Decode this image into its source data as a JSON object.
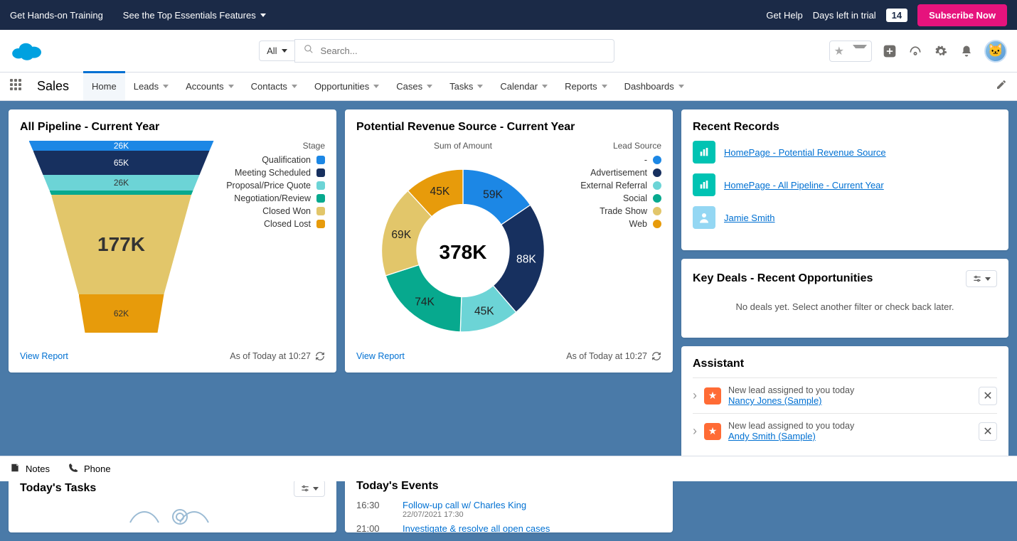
{
  "topbar": {
    "training": "Get Hands-on Training",
    "features": "See the Top Essentials Features",
    "get_help": "Get Help",
    "days_label": "Days left in trial",
    "days_value": "14",
    "subscribe": "Subscribe Now"
  },
  "search": {
    "scope": "All",
    "placeholder": "Search..."
  },
  "nav": {
    "app": "Sales",
    "tabs": [
      "Home",
      "Leads",
      "Accounts",
      "Contacts",
      "Opportunities",
      "Cases",
      "Tasks",
      "Calendar",
      "Reports",
      "Dashboards"
    ]
  },
  "pipeline": {
    "title": "All Pipeline - Current Year",
    "legend_title": "Stage",
    "stages": [
      {
        "name": "Qualification",
        "value": "26K",
        "color": "#1c87e5"
      },
      {
        "name": "Meeting Scheduled",
        "value": "65K",
        "color": "#17305f"
      },
      {
        "name": "Proposal/Price Quote",
        "value": "26K",
        "color": "#6cd4d6"
      },
      {
        "name": "Negotiation/Review",
        "value": "",
        "color": "#07a98e"
      },
      {
        "name": "Closed Won",
        "value": "177K",
        "color": "#e2c66a"
      },
      {
        "name": "Closed Lost",
        "value": "62K",
        "color": "#e79b0b"
      }
    ],
    "view_report": "View Report",
    "as_of": "As of Today at 10:27"
  },
  "revenue": {
    "title": "Potential Revenue Source - Current Year",
    "sub": "Sum of Amount",
    "legend_title": "Lead Source",
    "center": "378K",
    "sources": [
      {
        "name": "-",
        "label": "59K",
        "value": 59,
        "color": "#1c87e5"
      },
      {
        "name": "Advertisement",
        "label": "88K",
        "value": 88,
        "color": "#17305f"
      },
      {
        "name": "External Referral",
        "label": "45K",
        "value": 45,
        "color": "#6cd4d6"
      },
      {
        "name": "Social",
        "label": "74K",
        "value": 74,
        "color": "#07a98e"
      },
      {
        "name": "Trade Show",
        "label": "69K",
        "value": 69,
        "color": "#e2c66a"
      },
      {
        "name": "Web",
        "label": "45K",
        "value": 45,
        "color": "#e79b0b"
      }
    ],
    "view_report": "View Report",
    "as_of": "As of Today at 10:27"
  },
  "recent": {
    "title": "Recent Records",
    "items": [
      {
        "type": "report",
        "label": "HomePage - Potential Revenue Source"
      },
      {
        "type": "report",
        "label": "HomePage - All Pipeline - Current Year"
      },
      {
        "type": "contact",
        "label": "Jamie Smith"
      }
    ]
  },
  "deals": {
    "title": "Key Deals - Recent Opportunities",
    "empty": "No deals yet. Select another filter or check back later."
  },
  "tasks": {
    "title": "Today's Tasks"
  },
  "events": {
    "title": "Today's Events",
    "rows": [
      {
        "time": "16:30",
        "title": "Follow-up call w/ Charles King",
        "sub": "22/07/2021 17:30"
      },
      {
        "time": "21:00",
        "title": "Investigate & resolve all open cases",
        "sub": ""
      }
    ]
  },
  "assistant": {
    "title": "Assistant",
    "items": [
      {
        "msg": "New lead assigned to you today",
        "link": "Nancy Jones (Sample)"
      },
      {
        "msg": "New lead assigned to you today",
        "link": "Andy Smith (Sample)"
      }
    ]
  },
  "bottom": {
    "notes": "Notes",
    "phone": "Phone"
  },
  "chart_data": [
    {
      "type": "funnel",
      "title": "All Pipeline - Current Year",
      "legend_title": "Stage",
      "categories": [
        "Qualification",
        "Meeting Scheduled",
        "Proposal/Price Quote",
        "Negotiation/Review",
        "Closed Won",
        "Closed Lost"
      ],
      "values_label": [
        "26K",
        "65K",
        "26K",
        "",
        "177K",
        "62K"
      ],
      "values": [
        26,
        65,
        26,
        0,
        177,
        62
      ],
      "colors": [
        "#1c87e5",
        "#17305f",
        "#6cd4d6",
        "#07a98e",
        "#e2c66a",
        "#e79b0b"
      ]
    },
    {
      "type": "donut",
      "title": "Potential Revenue Source - Current Year",
      "subtitle": "Sum of Amount",
      "legend_title": "Lead Source",
      "center_label": "378K",
      "series": [
        {
          "name": "Sum of Amount",
          "values": [
            59,
            88,
            45,
            74,
            69,
            45
          ],
          "labels": [
            "59K",
            "88K",
            "45K",
            "74K",
            "69K",
            "45K"
          ]
        }
      ],
      "categories": [
        "-",
        "Advertisement",
        "External Referral",
        "Social",
        "Trade Show",
        "Web"
      ],
      "colors": [
        "#1c87e5",
        "#17305f",
        "#6cd4d6",
        "#07a98e",
        "#e2c66a",
        "#e79b0b"
      ]
    }
  ]
}
